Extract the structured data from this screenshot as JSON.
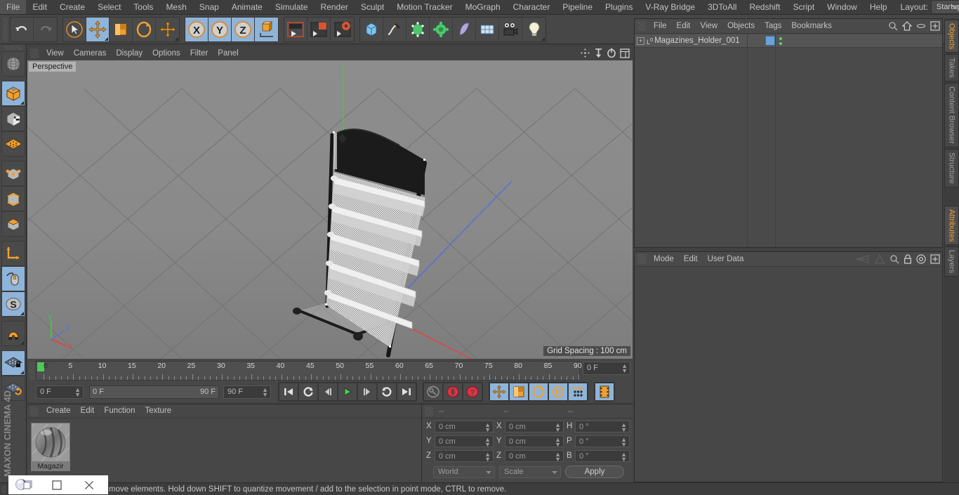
{
  "app": {
    "title": "Cinema 4D",
    "brand": "MAXON CINEMA 4D"
  },
  "menubar": {
    "items": [
      {
        "label": "File"
      },
      {
        "label": "Edit"
      },
      {
        "label": "Create"
      },
      {
        "label": "Select"
      },
      {
        "label": "Tools"
      },
      {
        "label": "Mesh"
      },
      {
        "label": "Snap"
      },
      {
        "label": "Animate"
      },
      {
        "label": "Simulate"
      },
      {
        "label": "Render"
      },
      {
        "label": "Sculpt"
      },
      {
        "label": "Motion Tracker"
      },
      {
        "label": "MoGraph"
      },
      {
        "label": "Character"
      },
      {
        "label": "Pipeline"
      },
      {
        "label": "Plugins"
      },
      {
        "label": "V-Ray Bridge"
      },
      {
        "label": "3DToAll"
      },
      {
        "label": "Redshift"
      },
      {
        "label": "Script"
      },
      {
        "label": "Window"
      },
      {
        "label": "Help"
      }
    ],
    "layout_label": "Layout:",
    "layout_value": "Startup",
    "search_icon": "search-icon"
  },
  "top_toolbar": {
    "groups": [
      {
        "name": "history",
        "buttons": [
          {
            "name": "undo-button",
            "icon": "undo-arrow-icon",
            "selected": false
          },
          {
            "name": "redo-button",
            "icon": "redo-arrow-icon",
            "selected": false
          }
        ]
      },
      {
        "name": "tools",
        "buttons": [
          {
            "name": "live-selection-tool",
            "icon": "cursor-circle-icon",
            "selected": false
          },
          {
            "name": "move-tool",
            "icon": "move-arrows-icon",
            "selected": true
          },
          {
            "name": "scale-tool",
            "icon": "scale-box-icon",
            "selected": false
          },
          {
            "name": "rotate-tool",
            "icon": "rotate-ring-icon",
            "selected": false
          },
          {
            "name": "position-tool",
            "icon": "move-plus-icon",
            "selected": false
          }
        ]
      },
      {
        "name": "axis-locks",
        "buttons": [
          {
            "name": "x-axis-lock",
            "icon": "x-axis-icon",
            "label": "X",
            "selected": true
          },
          {
            "name": "y-axis-lock",
            "icon": "y-axis-icon",
            "label": "Y",
            "selected": true
          },
          {
            "name": "z-axis-lock",
            "icon": "z-axis-icon",
            "label": "Z",
            "selected": true
          },
          {
            "name": "world-object-coordinate-toggle",
            "icon": "world-axis-icon",
            "selected": true
          }
        ]
      },
      {
        "name": "render",
        "buttons": [
          {
            "name": "render-view-button",
            "icon": "render-view-icon",
            "selected": false
          },
          {
            "name": "render-to-picture-viewer-button",
            "icon": "render-picture-icon",
            "selected": false
          },
          {
            "name": "render-settings-button",
            "icon": "render-settings-icon",
            "selected": false
          }
        ]
      },
      {
        "name": "create",
        "buttons": [
          {
            "name": "add-cube-object-button",
            "icon": "cube-icon",
            "selected": false
          },
          {
            "name": "add-spline-button",
            "icon": "pen-spline-icon",
            "selected": false
          },
          {
            "name": "add-generator-button",
            "icon": "generator-cube-icon",
            "selected": false
          },
          {
            "name": "add-deformer-button",
            "icon": "deformer-icon",
            "selected": false
          },
          {
            "name": "add-scene-object-button",
            "icon": "scene-surface-icon",
            "selected": false
          },
          {
            "name": "add-environment-button",
            "icon": "environment-grid-icon",
            "selected": false
          },
          {
            "name": "add-camera-button",
            "icon": "camera-icon",
            "selected": false
          },
          {
            "name": "add-light-button",
            "icon": "light-bulb-icon",
            "selected": false
          }
        ]
      }
    ]
  },
  "left_toolbar": {
    "buttons": [
      {
        "name": "undo-view-button",
        "icon": "globe-wire-icon",
        "selected": false
      },
      {
        "name": "make-editable-button",
        "icon": "editable-cube-icon",
        "selected": true
      },
      {
        "name": "model-mode-button",
        "icon": "model-checker-cube-icon",
        "selected": false
      },
      {
        "name": "texture-mode-button",
        "icon": "texture-grid-icon",
        "selected": false
      },
      {
        "name": "points-mode-button",
        "icon": "points-cube-icon",
        "selected": false
      },
      {
        "name": "edges-mode-button",
        "icon": "edges-cube-icon",
        "selected": false
      },
      {
        "name": "polygons-mode-button",
        "icon": "polygons-cube-icon",
        "selected": false
      },
      {
        "name": "axis-modify-button",
        "icon": "axis-corner-icon",
        "selected": false
      },
      {
        "name": "enable-snap-button",
        "icon": "mouse-icon",
        "selected": true
      },
      {
        "name": "viewport-solo-button",
        "icon": "s-circle-icon",
        "selected": true
      },
      {
        "name": "magnet-tool-button",
        "icon": "magnet-icon",
        "selected": false
      },
      {
        "name": "lock-workplane-button",
        "icon": "grid-lock-icon",
        "selected": true
      },
      {
        "name": "workplane-rotate-button",
        "icon": "grid-rotate-icon",
        "selected": false
      }
    ]
  },
  "viewport": {
    "menus": [
      {
        "label": "View"
      },
      {
        "label": "Cameras"
      },
      {
        "label": "Display"
      },
      {
        "label": "Options"
      },
      {
        "label": "Filter"
      },
      {
        "label": "Panel"
      }
    ],
    "icons": [
      {
        "name": "pan-view-icon"
      },
      {
        "name": "zoom-view-icon"
      },
      {
        "name": "rotate-view-icon"
      },
      {
        "name": "maximize-view-icon"
      }
    ],
    "perspective_label": "Perspective",
    "grid_spacing_label": "Grid Spacing : 100 cm",
    "axis_gizmo": {
      "x": "X",
      "y": "Y",
      "z": "Z",
      "x_color": "#e04545",
      "y_color": "#3ecb3e",
      "z_color": "#4f6fe0"
    },
    "scene_object": "Magazine display rack",
    "background_color": "#8a8a8a"
  },
  "timeline": {
    "ruler_ticks": [
      0,
      5,
      10,
      15,
      20,
      25,
      30,
      35,
      40,
      45,
      50,
      55,
      60,
      65,
      70,
      75,
      80,
      85,
      90
    ],
    "current_frame_field": "0 F",
    "start_field": "0 F",
    "slider_left": "0 F",
    "slider_right": "90 F",
    "end_field": "90 F",
    "transport": [
      {
        "name": "go-to-start-button",
        "icon": "skip-start-icon"
      },
      {
        "name": "previous-keyframe-button",
        "icon": "prev-key-icon"
      },
      {
        "name": "step-back-button",
        "icon": "step-back-icon"
      },
      {
        "name": "play-button",
        "icon": "play-icon"
      },
      {
        "name": "step-forward-button",
        "icon": "step-forward-icon"
      },
      {
        "name": "next-keyframe-button",
        "icon": "next-key-icon"
      },
      {
        "name": "go-to-end-button",
        "icon": "skip-end-icon"
      }
    ],
    "record_tools": [
      {
        "name": "autokeying-button",
        "icon": "key-circle-icon",
        "selected": false
      },
      {
        "name": "record-active-objects-button",
        "icon": "record-red-icon",
        "selected": false
      },
      {
        "name": "keyframe-help-button",
        "icon": "question-red-icon",
        "selected": false
      }
    ],
    "key_filters": [
      {
        "name": "record-position-button",
        "icon": "move-arrows-icon",
        "selected": true
      },
      {
        "name": "record-scale-button",
        "icon": "scale-box-icon",
        "selected": true
      },
      {
        "name": "record-rotation-button",
        "icon": "rotate-ring-icon",
        "selected": true
      },
      {
        "name": "record-pla-button",
        "icon": "p-circle-icon",
        "selected": true
      },
      {
        "name": "record-parameter-button",
        "icon": "dots-grid-icon",
        "selected": true
      }
    ],
    "extra": [
      {
        "name": "keyframe-selection-button",
        "icon": "filmstrip-icon",
        "selected": true
      }
    ]
  },
  "material_manager": {
    "menus": [
      {
        "label": "Create"
      },
      {
        "label": "Edit"
      },
      {
        "label": "Function"
      },
      {
        "label": "Texture"
      }
    ],
    "materials": [
      {
        "name": "Magazir",
        "preview": "sphere-preview"
      }
    ]
  },
  "coordinates": {
    "headers": [
      "--",
      "--",
      "--"
    ],
    "position": {
      "label_x": "X",
      "label_y": "Y",
      "label_z": "Z",
      "x": "0 cm",
      "y": "0 cm",
      "z": "0 cm"
    },
    "size": {
      "label_x": "X",
      "label_y": "Y",
      "label_z": "Z",
      "x": "0 cm",
      "y": "0 cm",
      "z": "0 cm"
    },
    "rotation": {
      "label_h": "H",
      "label_p": "P",
      "label_b": "B",
      "h": "0 °",
      "p": "0 °",
      "b": "0 °"
    },
    "coord_system": "World",
    "size_mode": "Scale",
    "apply_label": "Apply"
  },
  "object_manager": {
    "menus": [
      {
        "label": "File"
      },
      {
        "label": "Edit"
      },
      {
        "label": "View"
      },
      {
        "label": "Objects"
      },
      {
        "label": "Tags"
      },
      {
        "label": "Bookmarks"
      }
    ],
    "icons": [
      {
        "name": "search-icon"
      },
      {
        "name": "home-icon"
      },
      {
        "name": "ellipse-icon"
      },
      {
        "name": "add-layer-icon"
      }
    ],
    "objects": [
      {
        "name": "Magazines_Holder_001",
        "level_badge": "0",
        "tag_color": "#6aa2d8",
        "has_dots": true
      }
    ]
  },
  "attribute_manager": {
    "menus": [
      {
        "label": "Mode"
      },
      {
        "label": "Edit"
      },
      {
        "label": "User Data"
      }
    ],
    "icons": [
      {
        "name": "previous-attribute-icon"
      },
      {
        "name": "next-attribute-icon"
      },
      {
        "name": "search-icon"
      },
      {
        "name": "lock-icon"
      },
      {
        "name": "target-icon"
      },
      {
        "name": "add-attribute-icon"
      }
    ],
    "content": ""
  },
  "right_tabs": {
    "group_top": [
      {
        "label": "Objects",
        "active": true
      },
      {
        "label": "Takes",
        "active": false
      },
      {
        "label": "Content Browser",
        "active": false
      },
      {
        "label": "Structure",
        "active": false
      }
    ],
    "group_bottom": [
      {
        "label": "Attributes",
        "active": true
      },
      {
        "label": "Layers",
        "active": false
      }
    ]
  },
  "statusbar": {
    "message": "move elements. Hold down SHIFT to quantize movement / add to the selection in point mode, CTRL to remove."
  },
  "window_controls": {
    "app_icon": "cinema4d-logo-icon",
    "restore": {
      "name": "restore-window-button",
      "icon": "restore-icon"
    },
    "maximize": {
      "name": "maximize-window-button",
      "icon": "maximize-icon"
    },
    "close": {
      "name": "close-window-button",
      "icon": "close-icon"
    }
  },
  "colors": {
    "panel_bg": "#474747",
    "selection_blue": "#8fb4d9",
    "accent_orange": "#f0a030",
    "viewport_bg": "#8a8a8a",
    "menu_bg": "#3d3d3d"
  }
}
